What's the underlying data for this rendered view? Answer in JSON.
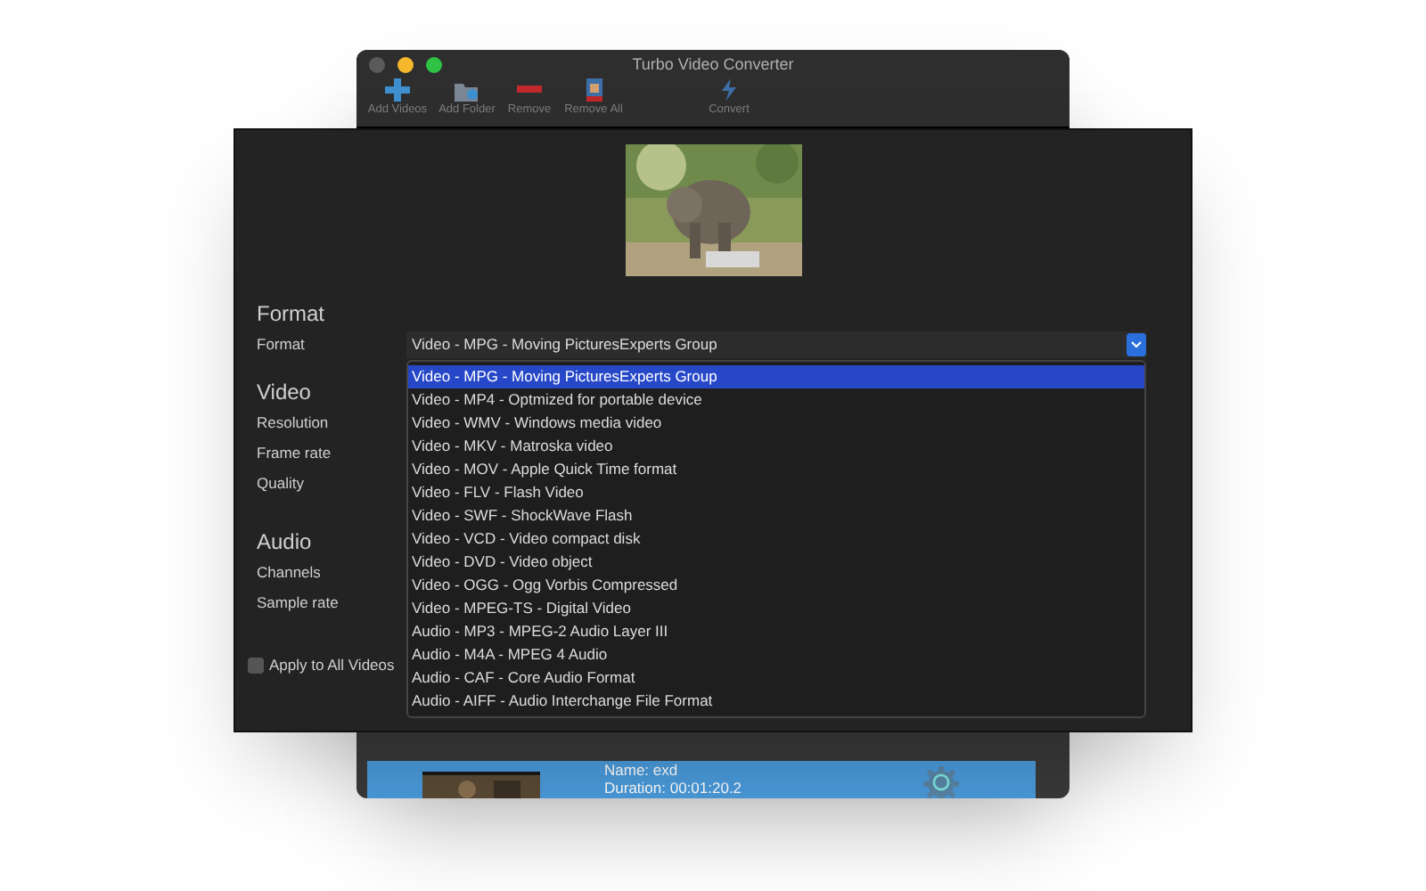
{
  "window": {
    "title": "Turbo Video Converter"
  },
  "toolbar": [
    {
      "label": "Add Videos",
      "kind": "add"
    },
    {
      "label": "Add Folder",
      "kind": "folder"
    },
    {
      "label": "Remove",
      "kind": "remove"
    },
    {
      "label": "Remove All",
      "kind": "removeall"
    },
    {
      "label": "Convert",
      "kind": "convert"
    }
  ],
  "sections": [
    {
      "title": "Format",
      "fields": [
        "Format"
      ]
    },
    {
      "title": "Video",
      "fields": [
        "Resolution",
        "Frame rate",
        "Quality"
      ]
    },
    {
      "title": "Audio",
      "fields": [
        "Channels",
        "Sample rate"
      ]
    }
  ],
  "format_select": {
    "value": "Video - MPG - Moving PicturesExperts Group"
  },
  "format_options": [
    {
      "label": "Video - MPG - Moving PicturesExperts Group",
      "selected": true
    },
    {
      "label": "Video - MP4 - Optmized for portable device",
      "selected": false
    },
    {
      "label": "Video - WMV - Windows media video",
      "selected": false
    },
    {
      "label": "Video - MKV - Matroska video",
      "selected": false
    },
    {
      "label": "Video - MOV - Apple Quick Time format",
      "selected": false
    },
    {
      "label": "Video - FLV - Flash Video",
      "selected": false
    },
    {
      "label": "Video - SWF - ShockWave Flash",
      "selected": false
    },
    {
      "label": "Video - VCD - Video compact disk",
      "selected": false
    },
    {
      "label": "Video - DVD - Video object",
      "selected": false
    },
    {
      "label": "Video - OGG - Ogg Vorbis Compressed",
      "selected": false
    },
    {
      "label": "Video - MPEG-TS - Digital Video",
      "selected": false
    },
    {
      "label": "Audio - MP3 - MPEG-2 Audio Layer III",
      "selected": false
    },
    {
      "label": "Audio - M4A - MPEG 4 Audio",
      "selected": false
    },
    {
      "label": "Audio - CAF - Core Audio Format",
      "selected": false
    },
    {
      "label": "Audio - AIFF - Audio Interchange File Format",
      "selected": false
    }
  ],
  "apply_all": {
    "label": "Apply to All Videos",
    "checked": false
  },
  "file_list": [
    {
      "name": "Name: exd",
      "duration": "Duration:  00:01:20.2"
    }
  ]
}
